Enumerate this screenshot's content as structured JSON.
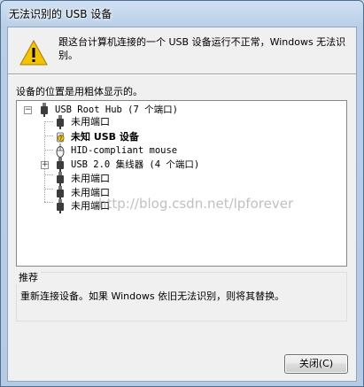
{
  "window": {
    "title": "无法识别的 USB 设备"
  },
  "message": "跟这台计算机连接的一个 USB 设备运行不正常，Windows 无法识别。",
  "tree_label": "设备的位置是用粗体显示的。",
  "tree": {
    "root": "USB Root Hub (7 个端口)",
    "children": [
      "未用端口",
      "未知 USB 设备",
      "HID-compliant mouse",
      "USB 2.0 集线器 (4 个端口)",
      "未用端口",
      "未用端口",
      "未用端口"
    ]
  },
  "hint": {
    "title": "推荐",
    "text": "重新连接设备。如果 Windows 依旧无法识别，则将其替换。"
  },
  "buttons": {
    "close_label": "关闭(C)"
  },
  "watermark": "http://blog.csdn.net/lpforever",
  "colors": {
    "warning": "#f5c400",
    "titlebar": "#c5d8ee",
    "frame": "#4e6f93"
  }
}
